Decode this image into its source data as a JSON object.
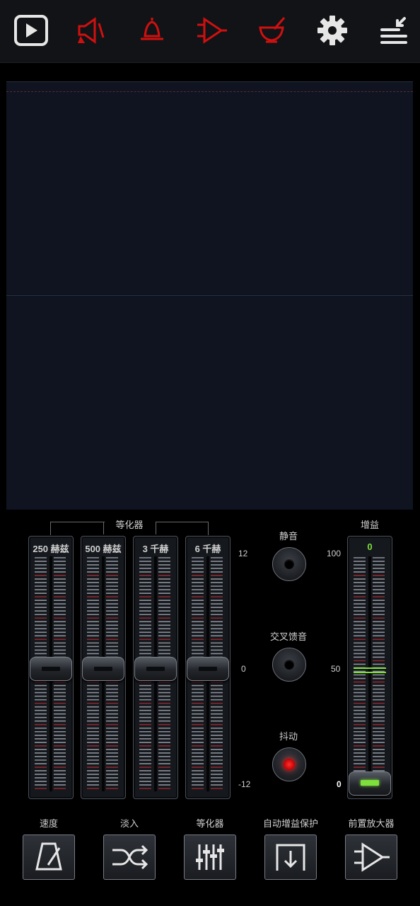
{
  "toolbar": {
    "play_icon": "play-icon",
    "icons": [
      "speaker-icon",
      "bell-icon",
      "amplifier-icon",
      "mortar-icon",
      "gear-icon",
      "menu-collapse-icon"
    ],
    "colors": {
      "active": "#e6e6e6",
      "alert": "#d01010"
    }
  },
  "equalizer": {
    "group_label": "等化器",
    "bands": [
      {
        "label": "250 赫兹",
        "value": 0
      },
      {
        "label": "500 赫兹",
        "value": 0
      },
      {
        "label": "3 千赫",
        "value": 0
      },
      {
        "label": "6 千赫",
        "value": 0
      }
    ],
    "scale": {
      "top": "12",
      "mid": "0",
      "bottom": "-12"
    }
  },
  "toggles": [
    {
      "label": "静音",
      "state": "off"
    },
    {
      "label": "交叉馈音",
      "state": "off"
    },
    {
      "label": "抖动",
      "state": "on"
    }
  ],
  "gain": {
    "label": "增益",
    "value_label": "0",
    "level": 0,
    "scale": {
      "top": "100",
      "mid": "50",
      "bottom": "0"
    },
    "accent": "#7ee03a"
  },
  "bottom_buttons": [
    {
      "label": "速度",
      "icon": "metronome-icon"
    },
    {
      "label": "淡入",
      "icon": "crossfade-icon"
    },
    {
      "label": "等化器",
      "icon": "equalizer-sliders-icon"
    },
    {
      "label": "自动增益保护",
      "icon": "gate-icon"
    },
    {
      "label": "前置放大器",
      "icon": "preamp-icon"
    }
  ]
}
